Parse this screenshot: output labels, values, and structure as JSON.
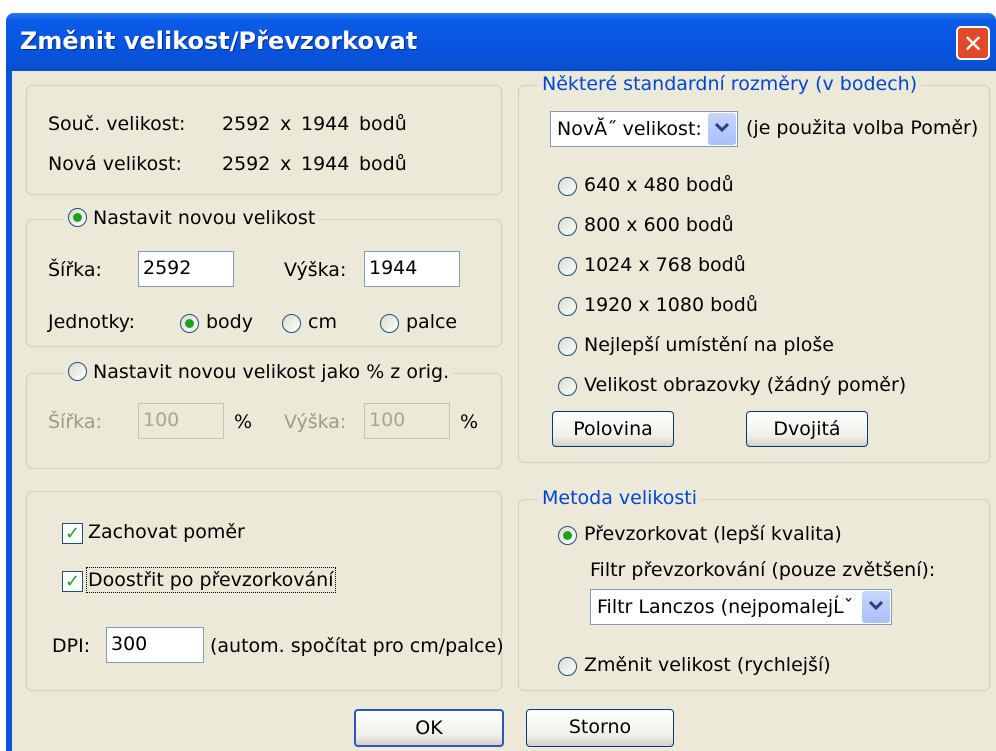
{
  "window": {
    "title": "Změnit velikost/Převzorkovat",
    "close_label": "✕"
  },
  "current": {
    "cur_label": "Souč. velikost:",
    "cur_w": "2592",
    "x1": "x",
    "cur_h": "1944",
    "cur_unit": "bodů",
    "new_label": "Nová velikost:",
    "new_w": "2592",
    "x2": "x",
    "new_h": "1944",
    "new_unit": "bodů"
  },
  "new_size": {
    "option_label": "Nastavit novou velikost",
    "width_label": "Šířka:",
    "width_value": "2592",
    "height_label": "Výška:",
    "height_value": "1944",
    "units_label": "Jednotky:",
    "units": [
      "body",
      "cm",
      "palce"
    ]
  },
  "percent": {
    "option_label": "Nastavit novou velikost jako % z orig.",
    "width_label": "Šířka:",
    "width_value": "100",
    "pct1": "%",
    "height_label": "Výška:",
    "height_value": "100",
    "pct2": "%"
  },
  "options": {
    "keep_ratio": "Zachovat poměr",
    "sharpen": "Doostřit po převzorkování",
    "dpi_label": "DPI:",
    "dpi_value": "300",
    "dpi_note": "(autom. spočítat pro cm/palce)"
  },
  "standard": {
    "title": "Některé standardní rozměry (v bodech)",
    "combo_value": "NovĂ˝ velikost:",
    "combo_note": "(je použita volba Poměr)",
    "sizes": [
      "640 x 480 bodů",
      "800 x 600 bodů",
      "1024 x 768 bodů",
      "1920 x 1080 bodů",
      "Nejlepší umístění na ploše",
      "Velikost obrazovky (žádný poměr)"
    ],
    "half_button": "Polovina",
    "double_button": "Dvojitá"
  },
  "method": {
    "title": "Metoda velikosti",
    "resample": "Převzorkovat (lepší kvalita)",
    "filter_label": "Filtr převzorkování (pouze zvětšení):",
    "filter_value": "Filtr Lanczos (nejpomalejĹˇ",
    "resize": "Změnit velikost (rychlejší)"
  },
  "buttons": {
    "ok": "OK",
    "cancel": "Storno"
  },
  "colors": {
    "title_bar": "#0a5ce8",
    "dialog_bg": "#ece9d8",
    "group_title": "#0046d5",
    "check_green": "#21a121"
  }
}
